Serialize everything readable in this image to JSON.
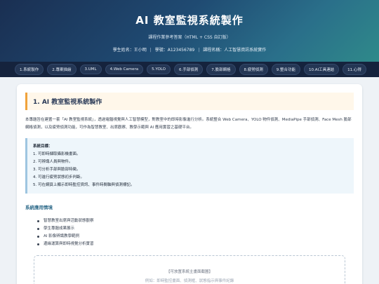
{
  "header": {
    "title": "AI 教室監視系統製作",
    "subtitle": "課程作業參考答案（HTML + CSS 自訂版）",
    "student_name": "學生姓名：王小明",
    "student_id": "學號：A123456789",
    "department": "課程名稱：人工智慧資訊系統實作"
  },
  "nav": {
    "items": [
      "1.系統製作",
      "2.專案描繪",
      "3.UML",
      "4.Web Camera",
      "5.YOLO",
      "6.手部偵測",
      "7.臉部網格",
      "8.疲勞偵測",
      "9.整合功能",
      "10.AI工具連結",
      "11.心得"
    ]
  },
  "section": {
    "title": "1. AI 教室監視系統製作",
    "intro": "本專題旨在建置一套「AI 教室監視系統」，透過電腦視覺與人工智慧模型，對教室中的即時影像進行分析。系統整合 Web Camera、YOLO 物件偵測、MediaPipe 手部偵測、Face Mesh 臉部網格偵測，以及疲勞偵測功能，可作為智慧教室、出席觀察、教學示範與 AI 應用實習之基礎平台。",
    "goals_title": "系統目標：",
    "goals": [
      "1. 可即時擷取攝影機畫面。",
      "2. 可辨識人員與物件。",
      "3. 可分析手部與臉部特徵。",
      "4. 可進行疲勞狀態初步判斷。",
      "5. 可在網頁上顯示即時監控資訊、事件時間軸與偵測標記。"
    ],
    "usage_title": "系統應用情境",
    "usage": [
      "智慧教室出席與活動狀態觀察",
      "學生專題成果展示",
      "AI 影像辨識教學範例",
      "邊緣運算與即時視覺分析實習"
    ],
    "placeholder_text": "【可放置系統主畫面截圖】",
    "placeholder_sub": "例如：即時監控畫面、偵測框、狀態指示與事件紀錄"
  }
}
